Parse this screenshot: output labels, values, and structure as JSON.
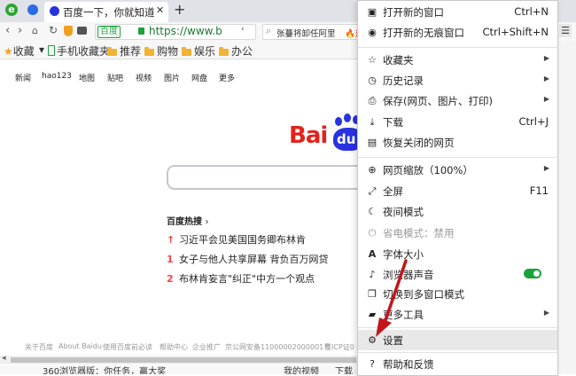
{
  "browser": {
    "tab_title": "百度一下，你就知道",
    "new_tab_symbol": "+",
    "site_badge": "百度",
    "url": "https://www.b",
    "news_ticker": "张蔓将卸任阿里",
    "news_ticker_tail": "热",
    "bookmarks": [
      "收藏",
      "手机收藏夹",
      "推荐",
      "购物",
      "娱乐",
      "办公"
    ]
  },
  "page": {
    "nav_links": [
      "新闻",
      "hao123",
      "地图",
      "贴吧",
      "视频",
      "图片",
      "网盘",
      "更多"
    ],
    "logo_text": "Bai",
    "logo_text2": "du",
    "hot_title": "百度热搜",
    "hot_items": [
      {
        "rank": "↑",
        "text": "习近平会见美国国务卿布林肯"
      },
      {
        "rank": "1",
        "text": "女子与他人共享屏幕 背负百万网贷"
      },
      {
        "rank": "2",
        "text": "布林肯妄言\"纠正\"中方一个观点"
      }
    ],
    "footer_links": [
      "关于百度",
      "About Baidu",
      "使用百度前必读",
      "帮助中心",
      "企业推广",
      "京公网安备11000002000001号",
      "京ICP证0"
    ],
    "bottom_fragments": [
      "360浏览器版：你任务，赢大奖",
      "我的视频",
      "下载"
    ]
  },
  "menu": {
    "items": [
      {
        "icon": "new-window-icon",
        "label": "打开新的窗口",
        "shortcut": "Ctrl+N"
      },
      {
        "icon": "incognito-icon",
        "label": "打开新的无痕窗口",
        "shortcut": "Ctrl+Shift+N"
      },
      {
        "icon": "star-icon",
        "label": "收藏夹",
        "submenu": true
      },
      {
        "icon": "history-icon",
        "label": "历史记录",
        "submenu": true
      },
      {
        "icon": "save-icon",
        "label": "保存(网页、图片、打印)",
        "submenu": true
      },
      {
        "icon": "download-icon",
        "label": "下载",
        "shortcut": "Ctrl+J"
      },
      {
        "icon": "restore-icon",
        "label": "恢复关闭的网页"
      },
      {
        "icon": "zoom-icon",
        "label": "网页缩放（100%）",
        "submenu": true
      },
      {
        "icon": "fullscreen-icon",
        "label": "全屏",
        "shortcut": "F11"
      },
      {
        "icon": "moon-icon",
        "label": "夜间模式"
      },
      {
        "icon": "power-saver-icon",
        "label": "省电模式：禁用",
        "disabled": true
      },
      {
        "icon": "font-size-icon",
        "label": "字体大小"
      },
      {
        "icon": "sound-icon",
        "label": "浏览器声音",
        "toggle_on": true
      },
      {
        "icon": "multi-window-icon",
        "label": "切换到多窗口模式"
      },
      {
        "icon": "tools-icon",
        "label": "更多工具",
        "submenu": true
      },
      {
        "icon": "gear-icon",
        "label": "设置",
        "highlighted": true
      },
      {
        "icon": "help-icon",
        "label": "帮助和反馈"
      }
    ]
  },
  "colors": {
    "accent_red": "#e2231a",
    "baidu_blue": "#2932e1",
    "toggle_green": "#1aa33a",
    "hot_red": "#f54545"
  }
}
